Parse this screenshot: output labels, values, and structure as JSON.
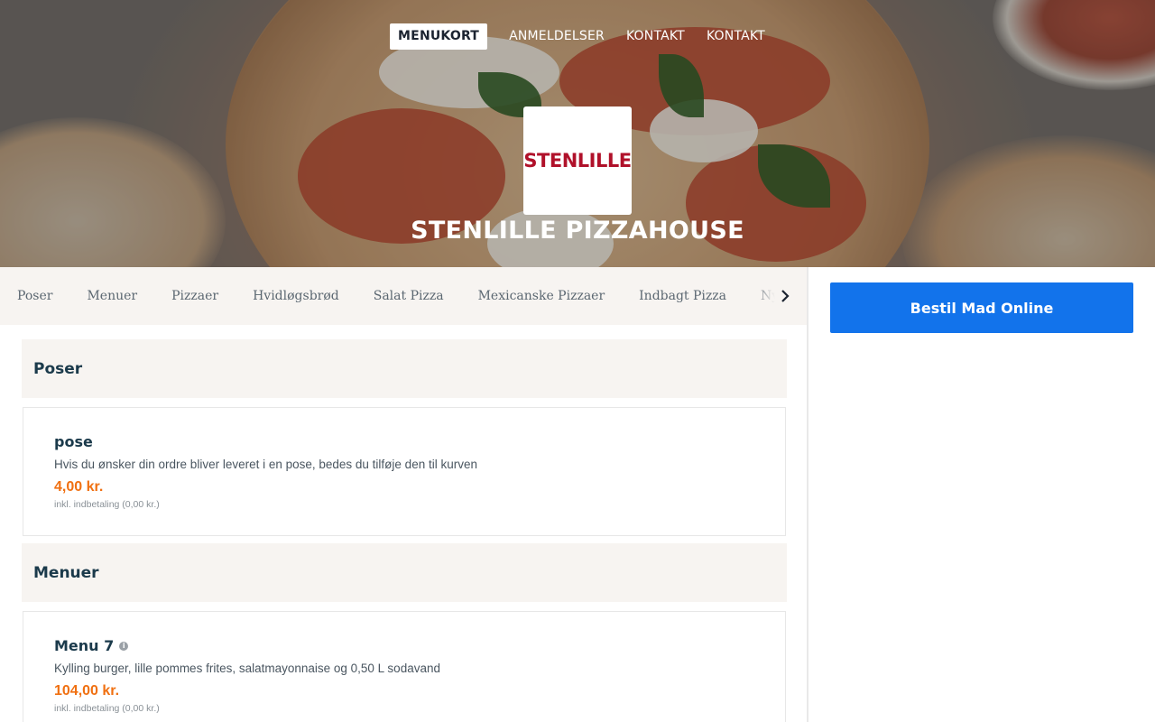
{
  "nav": {
    "items": [
      {
        "label": "MENUKORT",
        "active": true
      },
      {
        "label": "ANMELDELSER",
        "active": false
      },
      {
        "label": "KONTAKT",
        "active": false
      },
      {
        "label": "KONTAKT",
        "active": false
      }
    ]
  },
  "hero": {
    "logo_text": "STENLILLE",
    "title": "STENLILLE PIZZAHOUSE"
  },
  "categories": [
    "Poser",
    "Menuer",
    "Pizzaer",
    "Hvidløgsbrød",
    "Salat Pizza",
    "Mexicanske Pizzaer",
    "Indbagt Pizza",
    "Nye"
  ],
  "sections": [
    {
      "title": "Poser",
      "items": [
        {
          "name": "pose",
          "info": false,
          "description": "Hvis du ønsker din ordre bliver leveret i en pose, bedes du tilføje den til kurven",
          "price": "4,00 kr.",
          "note": "inkl. indbetaling (0,00 kr.)"
        }
      ]
    },
    {
      "title": "Menuer",
      "items": [
        {
          "name": "Menu 7",
          "info": true,
          "description": "Kylling burger, lille pommes frites, salatmayonnaise og 0,50 L sodavand",
          "price": "104,00 kr.",
          "note": "inkl. indbetaling (0,00 kr.)"
        }
      ]
    }
  ],
  "order": {
    "button_label": "Bestil Mad Online"
  },
  "colors": {
    "accent": "#1273eb",
    "price": "#f07011",
    "logo": "#b0112a",
    "heading": "#1b3a4b",
    "bar_bg": "#f7f4f1"
  }
}
